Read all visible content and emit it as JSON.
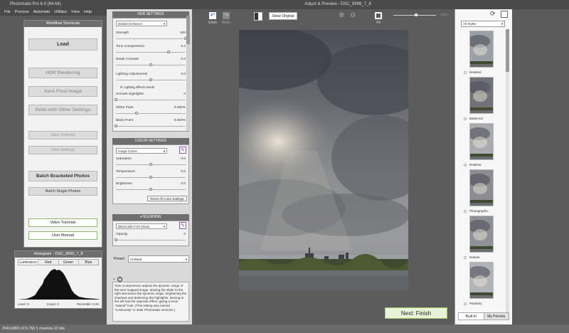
{
  "window": {
    "app_title": "Photomatix Pro 6.0 (64-bit)",
    "preview_title": "Adjust & Preview - DSC_8996_7_8"
  },
  "menu": [
    "File",
    "Process",
    "Automate",
    "Utilities",
    "View",
    "Help"
  ],
  "workflow": {
    "title": "Workflow Shortcuts",
    "load": "Load",
    "hdr_rendering": "HDR Rendering",
    "save_final": "Save Final Image",
    "redo": "Redo with Other Settings",
    "save_settings": "Save Settings",
    "view_settings": "View Settings",
    "batch_bracketed": "Batch Bracketed Photos",
    "batch_single": "Batch Single Photos",
    "video_tutorials": "Video Tutorials",
    "user_manual": "User Manual"
  },
  "histogram": {
    "title": "Histogram - DSC_8996_7_8",
    "tabs": [
      "Luminance",
      "Red",
      "Green",
      "Blue"
    ],
    "level": "Level: 0",
    "count": "Count: 0",
    "percentile": "Percentile: 0.00"
  },
  "hdr": {
    "title": "HDR SETTINGS",
    "method": "Details Enhancer",
    "sliders": [
      {
        "label": "Strength",
        "value": "100",
        "pos": 1.0
      },
      {
        "label": "Tone Compression",
        "value": "5.2",
        "pos": 0.76
      },
      {
        "label": "Detail Contrast",
        "value": "0.0",
        "pos": 0.5
      },
      {
        "label": "Lighting Adjustments",
        "value": "0.0",
        "pos": 0.5
      },
      {
        "label": "Smooth Highlights",
        "value": "0",
        "pos": 0.0
      },
      {
        "label": "White Point",
        "value": "0.250%",
        "pos": 0.3
      },
      {
        "label": "Black Point",
        "value": "0.000%",
        "pos": 0.0
      }
    ],
    "lighting_mode": "Lighting Effects Mode"
  },
  "color": {
    "title": "COLOR SETTINGS",
    "method": "Image Colors",
    "sliders": [
      {
        "label": "Saturation",
        "value": "0.0",
        "pos": 0.5
      },
      {
        "label": "Temperature",
        "value": "0.0",
        "pos": 0.5
      },
      {
        "label": "Brightness",
        "value": "0.0",
        "pos": 0.5
      }
    ],
    "reset": "Reset All Color Settings"
  },
  "blending": {
    "title": "BLENDING",
    "method": "Blend with 0 EV photo",
    "sliders": [
      {
        "label": "Opacity",
        "value": "0",
        "pos": 0.0
      }
    ]
  },
  "preset": {
    "label": "Preset:",
    "value": "Unlisted"
  },
  "help": {
    "text": "Tone Compression adjusts the dynamic range of the tone mapped image. Moving the slider to the right decreases the dynamic range, brightening the shadows and darkening the highlights. Moving to the left has the opposite effect, giving a more \"natural\" look. (This setting was named \"Luminosity\" in older Photomatix versions.)"
  },
  "toolbar": {
    "undo": "Undo",
    "redo": "Redo",
    "show_original": "Show Original",
    "fit": "Fit",
    "zoom": "100%"
  },
  "next_button": "Next: Finish",
  "styles": {
    "filter": "All Styles",
    "items": [
      "Detailed",
      "Balanced",
      "Realistic",
      "Photographic",
      "Natural",
      "Painterly"
    ],
    "tabs": [
      "Built-In",
      "My Presets"
    ]
  },
  "status": "2542x3865 (473.7M) 3 channels 32 bits"
}
